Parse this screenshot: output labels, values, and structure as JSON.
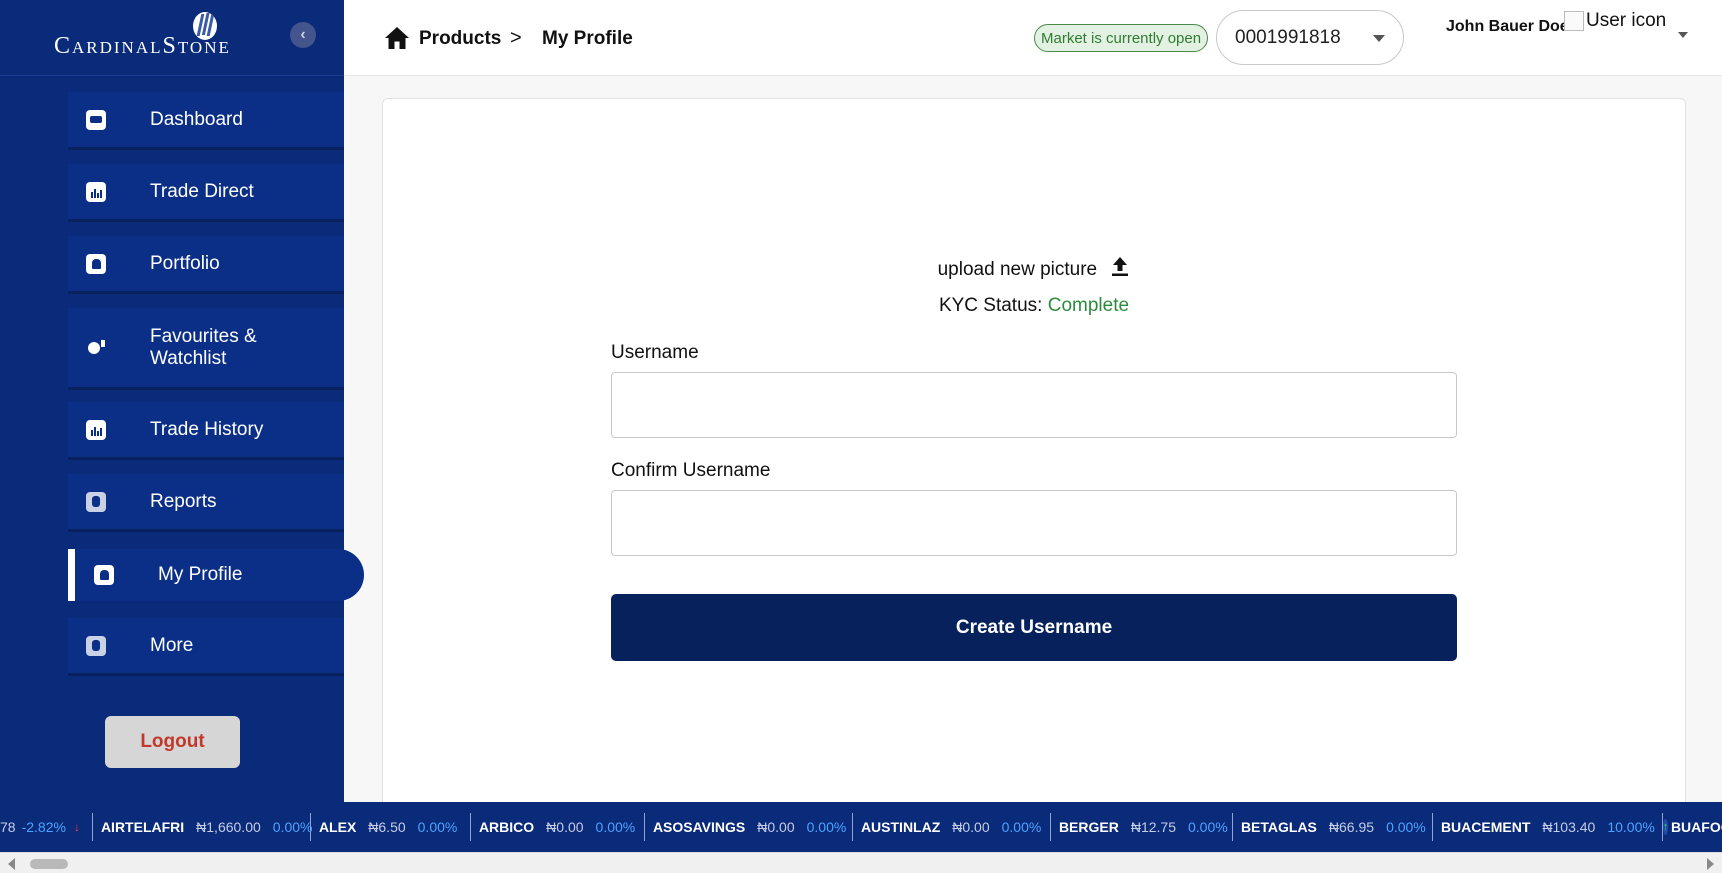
{
  "brand": {
    "name": "CardinalStone"
  },
  "sidebar": {
    "items": [
      {
        "label": "Dashboard",
        "icon": "dashboard-icon"
      },
      {
        "label": "Trade Direct",
        "icon": "chart-icon"
      },
      {
        "label": "Portfolio",
        "icon": "portfolio-icon"
      },
      {
        "label": "Favourites &",
        "label2": "Watchlist",
        "icon": "watchlist-icon"
      },
      {
        "label": "Trade History",
        "icon": "chart-icon"
      },
      {
        "label": "Reports",
        "icon": "reports-icon"
      },
      {
        "label": "My Profile",
        "icon": "profile-icon",
        "active": true
      },
      {
        "label": "More",
        "icon": "more-icon"
      }
    ],
    "logout_label": "Logout"
  },
  "header": {
    "breadcrumb": {
      "products": "Products",
      "separator": ">",
      "current": "My Profile"
    },
    "market_status": "Market is currently open",
    "account_number": "0001991818",
    "user_name": "John Bauer Doe",
    "user_icon_alt": "User icon"
  },
  "profile": {
    "upload_label": "upload new picture",
    "kyc_label": "KYC Status:",
    "kyc_value": "Complete",
    "username_label": "Username",
    "username_value": "",
    "confirm_label": "Confirm Username",
    "confirm_value": "",
    "create_button": "Create Username"
  },
  "ticker": [
    {
      "symbol": "",
      "price": "78",
      "change": "-2.82%",
      "direction": "down"
    },
    {
      "symbol": "AIRTELAFRI",
      "price": "₦1,660.00",
      "change": "0.00%",
      "direction": "none"
    },
    {
      "symbol": "ALEX",
      "price": "₦6.50",
      "change": "0.00%",
      "direction": "none"
    },
    {
      "symbol": "ARBICO",
      "price": "₦0.00",
      "change": "0.00%",
      "direction": "none"
    },
    {
      "symbol": "ASOSAVINGS",
      "price": "₦0.00",
      "change": "0.00%",
      "direction": "none"
    },
    {
      "symbol": "AUSTINLAZ",
      "price": "₦0.00",
      "change": "0.00%",
      "direction": "none"
    },
    {
      "symbol": "BERGER",
      "price": "₦12.75",
      "change": "0.00%",
      "direction": "none"
    },
    {
      "symbol": "BETAGLAS",
      "price": "₦66.95",
      "change": "0.00%",
      "direction": "none"
    },
    {
      "symbol": "BUACEMENT",
      "price": "₦103.40",
      "change": "10.00%",
      "direction": "up"
    },
    {
      "symbol": "BUAFOO",
      "price": "",
      "change": "",
      "direction": "none"
    }
  ],
  "colors": {
    "sidebar_bg": "#0a2a7a",
    "primary_button": "#06215c",
    "kyc_complete": "#2e8b3e",
    "market_open": "#2f7d32",
    "logout_text": "#c0392b",
    "ticker_change": "#4da3ff"
  }
}
